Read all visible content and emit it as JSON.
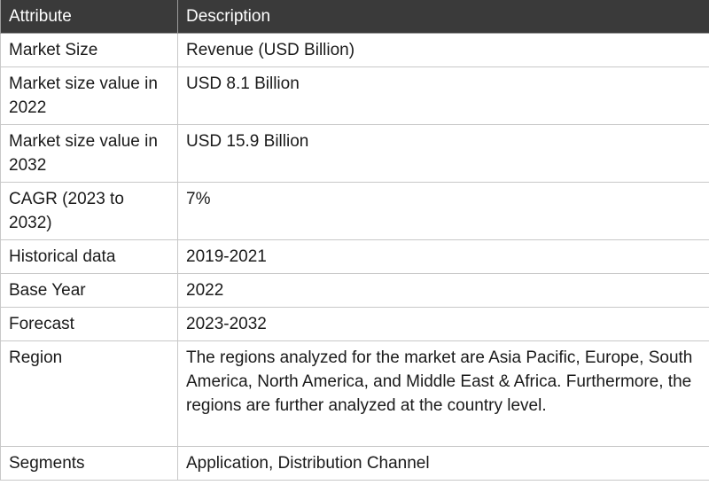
{
  "table": {
    "headers": [
      "Attribute",
      "Description"
    ],
    "rows": [
      {
        "attribute": "Market Size",
        "description": "Revenue (USD Billion)"
      },
      {
        "attribute": "Market size value in 2022",
        "description": "USD 8.1 Billion"
      },
      {
        "attribute": "Market size value in 2032",
        "description": "USD 15.9 Billion"
      },
      {
        "attribute": "CAGR (2023 to 2032)",
        "description": "7%"
      },
      {
        "attribute": "Historical data",
        "description": "2019-2021"
      },
      {
        "attribute": "Base Year",
        "description": "2022"
      },
      {
        "attribute": "Forecast",
        "description": "2023-2032"
      },
      {
        "attribute": "Region",
        "description": "The regions analyzed for the market are Asia Pacific, Europe, South America, North America, and Middle East & Africa. Furthermore, the regions are further analyzed at the country level."
      },
      {
        "attribute": "Segments",
        "description": "Application, Distribution Channel"
      }
    ]
  }
}
